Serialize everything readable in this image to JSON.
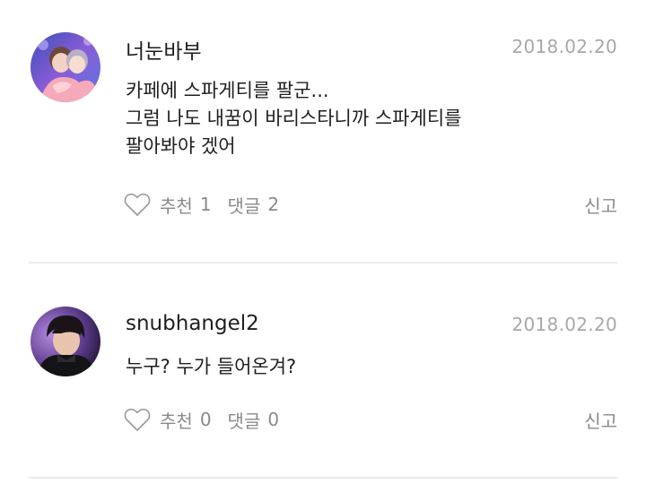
{
  "comments": [
    {
      "username": "너눈바부",
      "date": "2018.02.20",
      "text": "카페에 스파게티를 팔군...\n그럼 나도 내꿈이 바리스타니까 스파게티를\n팔아봐야 겠어",
      "like_label": "추천",
      "like_count": "1",
      "reply_label": "댓글",
      "reply_count": "2",
      "report_label": "신고",
      "avatar_icon": "user-avatar-photo"
    },
    {
      "username": "snubhangel2",
      "date": "2018.02.20",
      "text": "누구? 누가 들어온겨?",
      "like_label": "추천",
      "like_count": "0",
      "reply_label": "댓글",
      "reply_count": "0",
      "report_label": "신고",
      "avatar_icon": "user-avatar-photo"
    }
  ],
  "icons": {
    "like": "heart-outline-icon"
  },
  "colors": {
    "text": "#1f1f1f",
    "muted": "#8a8a8a",
    "date": "#a8a8a8",
    "divider": "#e6ebee"
  }
}
